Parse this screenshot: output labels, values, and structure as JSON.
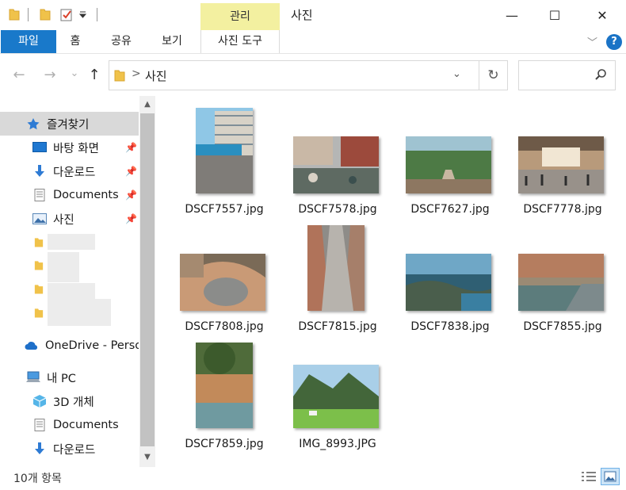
{
  "titlebar": {
    "context_tab": "관리",
    "title": "사진",
    "minimize_glyph": "—",
    "maximize_glyph": "☐",
    "close_glyph": "✕"
  },
  "ribbon": {
    "file_tab": "파일",
    "tabs": [
      "홈",
      "공유",
      "보기"
    ],
    "tool_tab": "사진 도구",
    "help_glyph": "?"
  },
  "address": {
    "path_segment": "사진",
    "separator": ">",
    "back_glyph": "←",
    "forward_glyph": "→",
    "recent_glyph": "⌄",
    "up_glyph": "↑",
    "dropdown_glyph": "⌄",
    "refresh_glyph": "↻"
  },
  "search": {
    "placeholder": ""
  },
  "nav": {
    "quick_access": "즐겨찾기",
    "pinned": [
      {
        "label": "바탕 화면",
        "icon": "desktop-icon"
      },
      {
        "label": "다운로드",
        "icon": "download-icon"
      },
      {
        "label": "Documents",
        "icon": "document-icon"
      },
      {
        "label": "사진",
        "icon": "pictures-icon"
      }
    ],
    "onedrive": "OneDrive - Perso",
    "this_pc": "내 PC",
    "pc_items": [
      {
        "label": "3D 개체",
        "icon": "3d-objects-icon"
      },
      {
        "label": "Documents",
        "icon": "document-icon"
      },
      {
        "label": "다운로드",
        "icon": "download-icon"
      }
    ]
  },
  "files": [
    {
      "name": "DSCF7557.jpg"
    },
    {
      "name": "DSCF7578.jpg"
    },
    {
      "name": "DSCF7627.jpg"
    },
    {
      "name": "DSCF7778.jpg"
    },
    {
      "name": "DSCF7808.jpg"
    },
    {
      "name": "DSCF7815.jpg"
    },
    {
      "name": "DSCF7838.jpg"
    },
    {
      "name": "DSCF7855.jpg"
    },
    {
      "name": "DSCF7859.jpg"
    },
    {
      "name": "IMG_8993.JPG"
    }
  ],
  "status": {
    "count_text": "10개 항목"
  },
  "colors": {
    "accent": "#1979ca",
    "context_tab": "#f3f0a0",
    "selected_nav": "#d9d9d9"
  }
}
